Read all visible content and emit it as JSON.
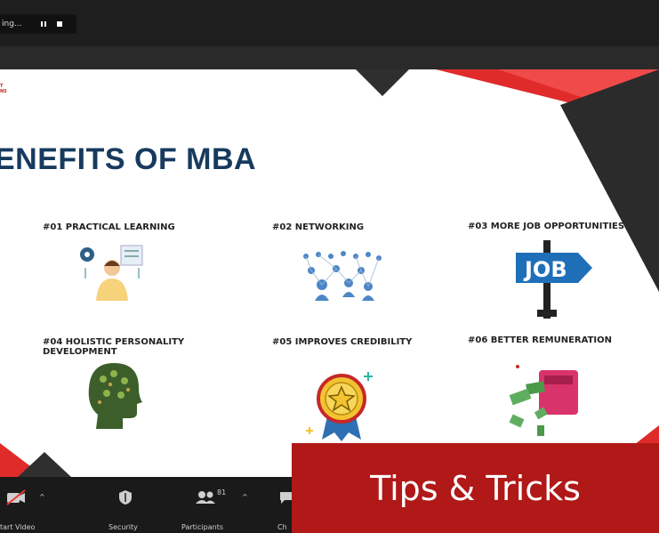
{
  "recording": {
    "status": "ing...",
    "pause_icon": "pause-icon",
    "stop_icon": "stop-icon"
  },
  "slide": {
    "logo_line1": "T",
    "logo_line2": "NS",
    "title": "ENEFITS OF MBA",
    "items": [
      {
        "label": "#01 PRACTICAL LEARNING",
        "icon": "person-with-gear-icon"
      },
      {
        "label": "#02 NETWORKING",
        "icon": "network-people-icon"
      },
      {
        "label": "#03 MORE JOB OPPORTUNITIES",
        "icon": "job-sign-icon"
      },
      {
        "label_line1": "#04 HOLISTIC PERSONALITY",
        "label_line2": "DEVELOPMENT",
        "icon": "brain-head-icon"
      },
      {
        "label": "#05 IMPROVES CREDIBILITY",
        "icon": "star-medal-icon"
      },
      {
        "label": "#06 BETTER REMUNERATION",
        "icon": "money-printer-icon"
      }
    ],
    "job_text": "JOB"
  },
  "toolbar": {
    "start_video": "tart Video",
    "security": "Security",
    "participants": "Participants",
    "participants_count": "81",
    "chat": "Ch"
  },
  "banner": {
    "text": "Tips & Tricks"
  },
  "colors": {
    "title": "#173a5e",
    "accent_red": "#e02b2b",
    "banner": "#b11818"
  }
}
